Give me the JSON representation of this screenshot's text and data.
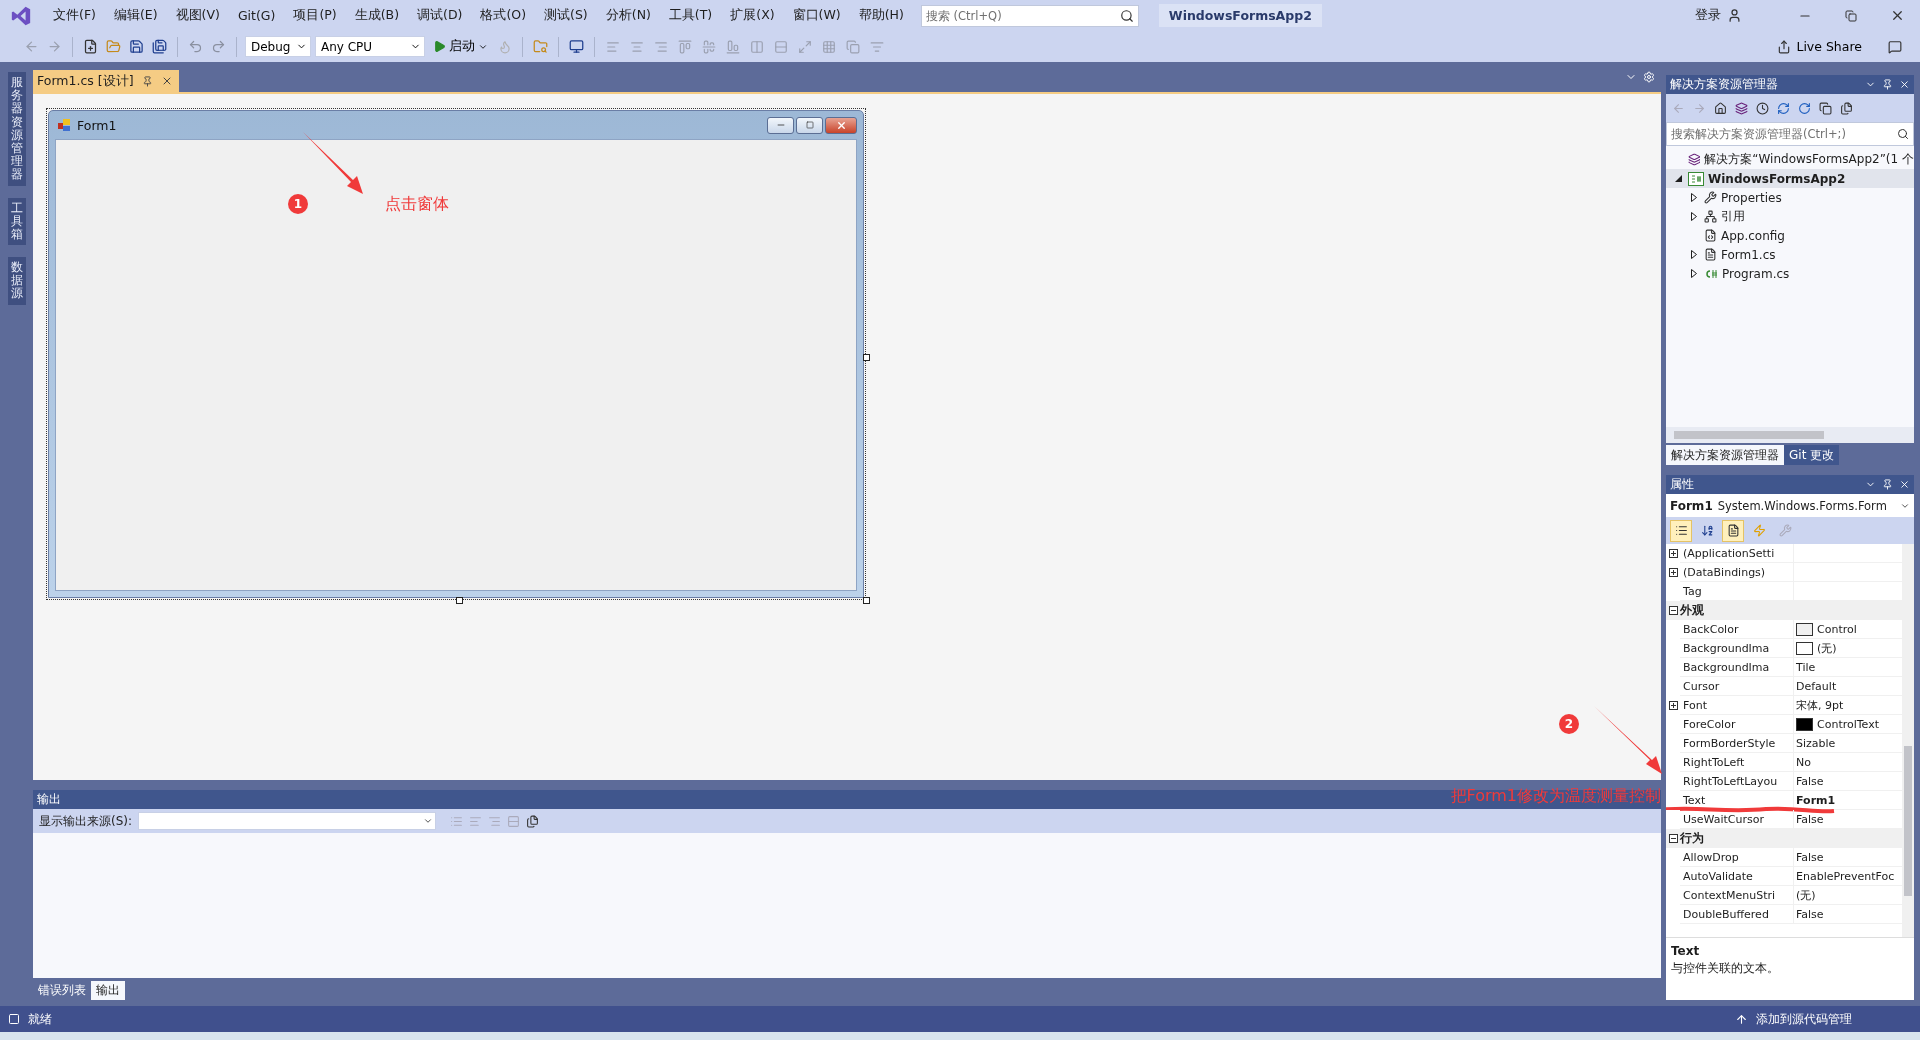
{
  "title_bar": {
    "menus": [
      "文件(F)",
      "编辑(E)",
      "视图(V)",
      "Git(G)",
      "项目(P)",
      "生成(B)",
      "调试(D)",
      "格式(O)",
      "测试(S)",
      "分析(N)",
      "工具(T)",
      "扩展(X)",
      "窗口(W)",
      "帮助(H)"
    ],
    "search": {
      "placeholder": "搜索 (Ctrl+Q)"
    },
    "solution_name": "WindowsFormsApp2",
    "sign_in": "登录"
  },
  "toolbar": {
    "configuration": "Debug",
    "platform": "Any CPU",
    "start": "启动",
    "live_share": "Live Share"
  },
  "left_tabs": [
    "服务器资源管理器",
    "工具箱",
    "数据源"
  ],
  "document_tabs": [
    {
      "label": "Form1.cs [设计]",
      "selected": true
    }
  ],
  "form_designer": {
    "form_title": "Form1"
  },
  "annotations": [
    {
      "number": "1",
      "text": "点击窗体"
    },
    {
      "number": "2",
      "text": "把Form1修改为温度测量控制"
    }
  ],
  "output_panel": {
    "title": "输出",
    "source_label": "显示输出来源(S):",
    "tabs": [
      {
        "label": "错误列表",
        "selected": false
      },
      {
        "label": "输出",
        "selected": true
      }
    ]
  },
  "solution_explorer": {
    "title": "解决方案资源管理器",
    "search": {
      "placeholder": "搜索解决方案资源管理器(Ctrl+;)"
    },
    "tree": [
      {
        "label": "解决方案“WindowsFormsApp2”(1 个",
        "kind": "solution",
        "expandable": false,
        "expanded": false,
        "selected": false
      },
      {
        "label": "WindowsFormsApp2",
        "kind": "project",
        "expandable": true,
        "expanded": true,
        "selected": true,
        "children": [
          {
            "label": "Properties",
            "kind": "wrench",
            "expandable": true,
            "expanded": false,
            "selected": false
          },
          {
            "label": "引用",
            "kind": "references",
            "expandable": true,
            "expanded": false,
            "selected": false
          },
          {
            "label": "App.config",
            "kind": "config",
            "expandable": false,
            "expanded": false,
            "selected": false
          },
          {
            "label": "Form1.cs",
            "kind": "form",
            "expandable": true,
            "expanded": false,
            "selected": false
          },
          {
            "label": "Program.cs",
            "kind": "csharp",
            "expandable": true,
            "expanded": false,
            "selected": false
          }
        ]
      }
    ],
    "tabs": [
      {
        "label": "解决方案资源管理器",
        "selected": true
      },
      {
        "label": "Git 更改",
        "selected": false
      }
    ]
  },
  "properties": {
    "title": "属性",
    "object_name": "Form1",
    "object_type": "System.Windows.Forms.Form",
    "rows": [
      {
        "kind": "group",
        "name": "(ApplicationSetti",
        "underlined": false
      },
      {
        "kind": "group",
        "name": "(DataBindings)",
        "underlined": false
      },
      {
        "kind": "property",
        "name": "Tag",
        "underlined": false
      },
      {
        "kind": "category",
        "name": "外观",
        "expanded": true
      },
      {
        "kind": "property",
        "name": "BackColor",
        "value": "Control",
        "color": "#f0f0f0",
        "modified": false,
        "underlined": false
      },
      {
        "kind": "property",
        "name": "BackgroundIma",
        "value": "(无)",
        "color": "#ffffff",
        "modified": false,
        "underlined": false
      },
      {
        "kind": "property",
        "name": "BackgroundIma",
        "value": "Tile",
        "modified": false,
        "underlined": false
      },
      {
        "kind": "property",
        "name": "Cursor",
        "value": "Default",
        "modified": false,
        "underlined": false
      },
      {
        "kind": "group",
        "name": "Font",
        "value": "宋体, 9pt",
        "modified": false,
        "underlined": false
      },
      {
        "kind": "property",
        "name": "ForeColor",
        "value": "ControlText",
        "color": "#000000",
        "modified": false,
        "underlined": false
      },
      {
        "kind": "property",
        "name": "FormBorderStyle",
        "value": "Sizable",
        "modified": false,
        "underlined": false
      },
      {
        "kind": "property",
        "name": "RightToLeft",
        "value": "No",
        "modified": false,
        "underlined": false
      },
      {
        "kind": "property",
        "name": "RightToLeftLayou",
        "value": "False",
        "modified": false,
        "underlined": false
      },
      {
        "kind": "property",
        "name": "Text",
        "value": "Form1",
        "modified": true,
        "underlined": true
      },
      {
        "kind": "property",
        "name": "UseWaitCursor",
        "value": "False",
        "modified": false,
        "underlined": false
      },
      {
        "kind": "category",
        "name": "行为",
        "expanded": true
      },
      {
        "kind": "property",
        "name": "AllowDrop",
        "value": "False",
        "modified": false,
        "underlined": false
      },
      {
        "kind": "property",
        "name": "AutoValidate",
        "value": "EnablePreventFoc",
        "modified": false,
        "underlined": false
      },
      {
        "kind": "property",
        "name": "ContextMenuStri",
        "value": "(无)",
        "modified": false,
        "underlined": false
      },
      {
        "kind": "property",
        "name": "DoubleBuffered",
        "value": "False",
        "modified": false,
        "underlined": false
      }
    ],
    "description": {
      "title": "Text",
      "text": "与控件关联的文本。"
    }
  },
  "status_bar": {
    "left": "就绪",
    "right": "添加到源代码管理"
  }
}
